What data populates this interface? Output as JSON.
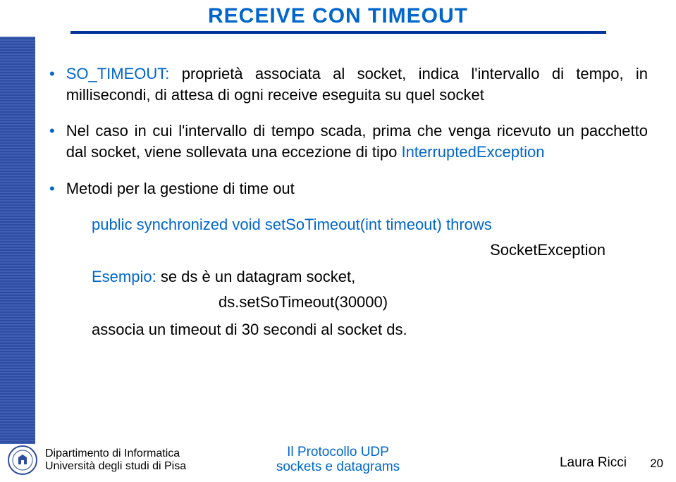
{
  "title": "RECEIVE CON TIMEOUT",
  "bullets": [
    {
      "prefix": "SO_TIMEOUT:",
      "rest": " proprietà associata al socket, indica l'intervallo di tempo, in millisecondi, di attesa di ogni receive eseguita su quel socket"
    },
    {
      "text1": "Nel caso in cui l'intervallo di tempo scada, prima che venga ricevuto un pacchetto dal socket, viene sollevata una eccezione di tipo ",
      "text2": "InterruptedException"
    },
    {
      "text": "Metodi per la gestione di time out"
    }
  ],
  "code_line": "public synchronized void setSoTimeout(int timeout) throws",
  "exception": "SocketException",
  "example_label": "Esempio:",
  "example_text": " se ds è un datagram socket,",
  "example_code": "ds.setSoTimeout(30000)",
  "example_desc": "associa un timeout di 30 secondi al socket ds.",
  "footer": {
    "dept_line1": "Dipartimento di Informatica",
    "dept_line2": "Università degli studi di Pisa",
    "center_line1": "Il Protocollo UDP",
    "center_line2": "sockets e datagrams",
    "author": "Laura Ricci",
    "page": "20"
  }
}
